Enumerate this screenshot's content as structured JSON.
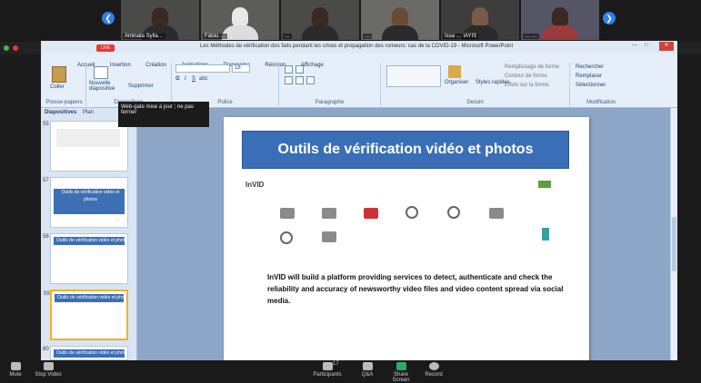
{
  "zoom": {
    "participants": [
      {
        "name": "Aminata Sylla…"
      },
      {
        "name": "Fatou …"
      },
      {
        "name": "…"
      },
      {
        "name": "…"
      },
      {
        "name": "Issa … IAYIS"
      },
      {
        "name": "… …"
      }
    ],
    "toolbar": {
      "mute": "Mute",
      "stop_video": "Stop Video",
      "participants": "Participants",
      "participants_count": "17",
      "qa": "Q&A",
      "share_screen": "Share Screen",
      "record": "Record"
    },
    "live_label": "LIVE"
  },
  "ppt": {
    "window_title": "Les Méthodes de vérification des faits pendant les crises et propagation des rumeurs: cas de la COVID-19 - Microsoft PowerPoint",
    "tabs": [
      "Accueil",
      "Insertion",
      "Création",
      "Animations",
      "Diaporama",
      "Révision",
      "Affichage"
    ],
    "groups": [
      "Presse-papiers",
      "Diapositives",
      "Police",
      "Paragraphe",
      "Dessin",
      "Modification"
    ],
    "buttons": {
      "paste": "Coller",
      "new_slide": "Nouvelle diapositive",
      "delete": "Supprimer",
      "arrange": "Organiser",
      "quick_styles": "Styles rapides",
      "find": "Rechercher",
      "replace": "Remplacer",
      "select": "Sélectionner",
      "shape_fill": "Remplissage de forme",
      "shape_outline": "Contour de forme",
      "shape_effects": "Effets sur la forme",
      "font_size": "18"
    },
    "tooltip": "Web-gate mise à jour ; ne pas fermer",
    "pane_tabs": [
      "Diapositives",
      "Plan"
    ],
    "thumbnails": [
      {
        "num": "55",
        "title": ""
      },
      {
        "num": "57",
        "title": "Outils de vérification vidéo et photos"
      },
      {
        "num": "58",
        "title": "Outils de vérification vidéo et photos"
      },
      {
        "num": "59",
        "title": "Outils de vérification vidéo et photos"
      },
      {
        "num": "60",
        "title": "Outils de vérification vidéo et photos"
      }
    ],
    "slide": {
      "title": "Outils de vérification vidéo et photos",
      "logo": "InVID",
      "body": "InVID will build a platform providing services to detect, authenticate and check the reliability and accuracy of newsworthy video files and video content spread via social media."
    }
  }
}
